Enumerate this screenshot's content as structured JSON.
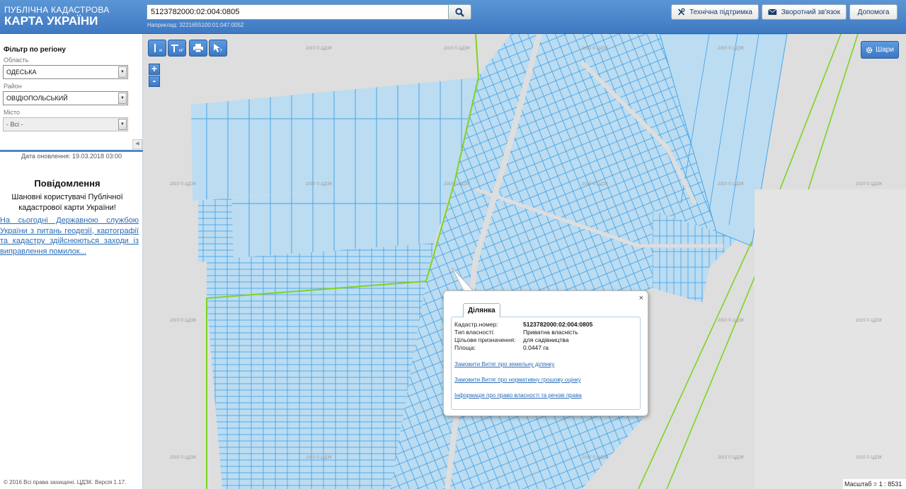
{
  "header": {
    "logo_line1": "ПУБЛІЧНА КАДАСТРОВА",
    "logo_line2": "КАРТА УКРАЇНИ",
    "search_value": "5123782000:02:004:0805",
    "example_text": "Наприклад: 3221655100:01:047:0052",
    "support_label": "Технічна підтримка",
    "feedback_label": "Зворотний зв'язок",
    "help_label": "Допомога"
  },
  "sidebar": {
    "filter_title": "Фільтр по регіону",
    "region_label": "Область",
    "region_value": "ОДЕСЬКА",
    "district_label": "Район",
    "district_value": "ОВІДІОПОЛЬСЬКИЙ",
    "city_label": "Місто",
    "city_value": "- Всі -",
    "update_text": "Дата оновлення: 19.03.2018 03:00",
    "news_title": "Повідомлення",
    "news_body": "Шановні користувачі Публічної кадастрової карти України!",
    "news_link": "На сьогодні Державною службою України з питань геодезії, картографії та кадастру здійснюються заходи із виправлення помилок...",
    "copyright": "© 2016 Всі права захищені. ЦДЗК. Версія 1.17."
  },
  "map": {
    "layers_label": "Шари",
    "zoom_in": "+",
    "zoom_out": "-",
    "scale_text": "Масштаб = 1 : 8531",
    "watermark": "2015 © ЦДЗК",
    "tools": {
      "measure_length": "м",
      "measure_area": "м²"
    },
    "colors": {
      "parcel_fill": "#bcdcf1",
      "parcel_stroke": "#3aa0e8",
      "boundary": "#7ed321",
      "header": "#4a86cc"
    }
  },
  "popup": {
    "tab_label": "Ділянка",
    "close": "×",
    "rows": [
      {
        "key": "Кадастр.номер:",
        "value": "5123782000:02:004:0805"
      },
      {
        "key": "Тип власності:",
        "value": "Приватна власність"
      },
      {
        "key": "Цільове призначення:",
        "value": "для садівництва"
      },
      {
        "key": "Площа:",
        "value": "0.0447 га"
      }
    ],
    "links": [
      "Замовити Витяг про земельну ділянку",
      "Замовити Витяг про нормативну грошову оцінку",
      "Інформація про право власності та речові права"
    ]
  }
}
